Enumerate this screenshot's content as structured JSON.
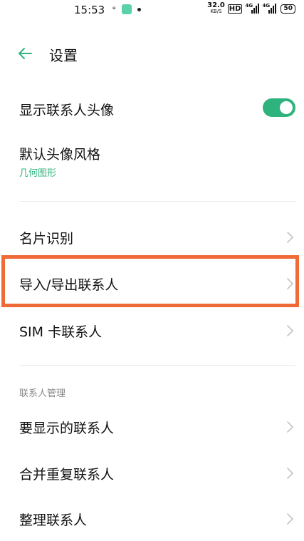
{
  "status_bar": {
    "time": "15:53",
    "net_speed_value": "32.0",
    "net_speed_unit": "KB/S",
    "hd_label": "HD",
    "signal1_label": "4G",
    "signal2_label": "4G",
    "battery": "50"
  },
  "header": {
    "title": "设置"
  },
  "settings": {
    "show_avatar_label": "显示联系人头像",
    "show_avatar_enabled": true,
    "default_avatar_style_label": "默认头像风格",
    "default_avatar_style_value": "几何图形",
    "business_card_label": "名片识别",
    "import_export_label": "导入/导出联系人",
    "sim_contacts_label": "SIM 卡联系人",
    "section_contact_management": "联系人管理",
    "contacts_to_display_label": "要显示的联系人",
    "merge_duplicates_label": "合并重复联系人",
    "organize_contacts_label": "整理联系人"
  },
  "colors": {
    "accent": "#2fb37e",
    "highlight": "#f06a37"
  }
}
